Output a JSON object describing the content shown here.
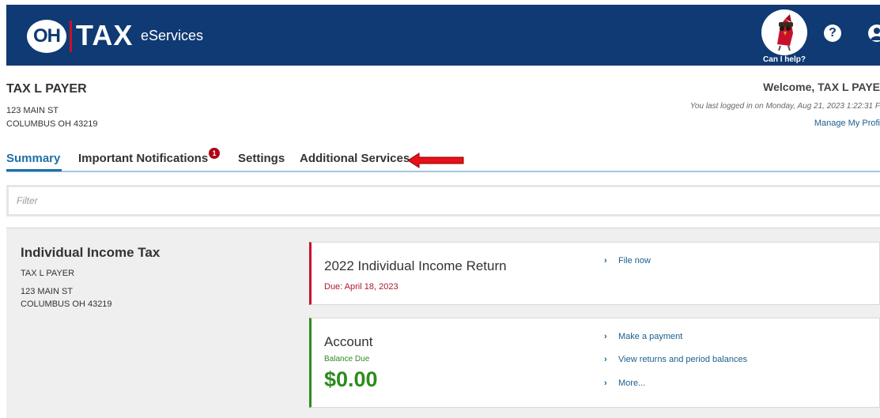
{
  "header": {
    "logo_oh": "OH",
    "logo_tax": "TAX",
    "logo_sub": "eServices",
    "helper_label": "Can I help?",
    "help_icon": "?",
    "colors": {
      "brand_blue": "#0f3a73",
      "brand_red": "#c8102e"
    }
  },
  "taxpayer": {
    "name": "TAX L PAYER",
    "address1": "123 MAIN ST",
    "address2": "COLUMBUS OH 43219"
  },
  "welcome": {
    "greeting": "Welcome, TAX L PAYE",
    "last_login": "You last logged in on Monday, Aug 21, 2023 1:22:31 F",
    "manage_profile": "Manage My Profi"
  },
  "tabs": [
    {
      "label": "Summary",
      "active": true
    },
    {
      "label": "Important Notifications",
      "badge": "1"
    },
    {
      "label": "Settings"
    },
    {
      "label": "Additional Services"
    }
  ],
  "filter": {
    "placeholder": "Filter"
  },
  "account": {
    "title": "Individual Income Tax",
    "name": "TAX L PAYER",
    "address1": "123 MAIN ST",
    "address2": "COLUMBUS OH 43219"
  },
  "return_card": {
    "title": "2022 Individual Income Return",
    "due": "Due: April 18, 2023",
    "links": [
      "File now"
    ]
  },
  "account_card": {
    "title": "Account",
    "balance_label": "Balance Due",
    "balance_value": "$0.00",
    "links": [
      "Make a payment",
      "View returns and period balances",
      "More..."
    ]
  }
}
